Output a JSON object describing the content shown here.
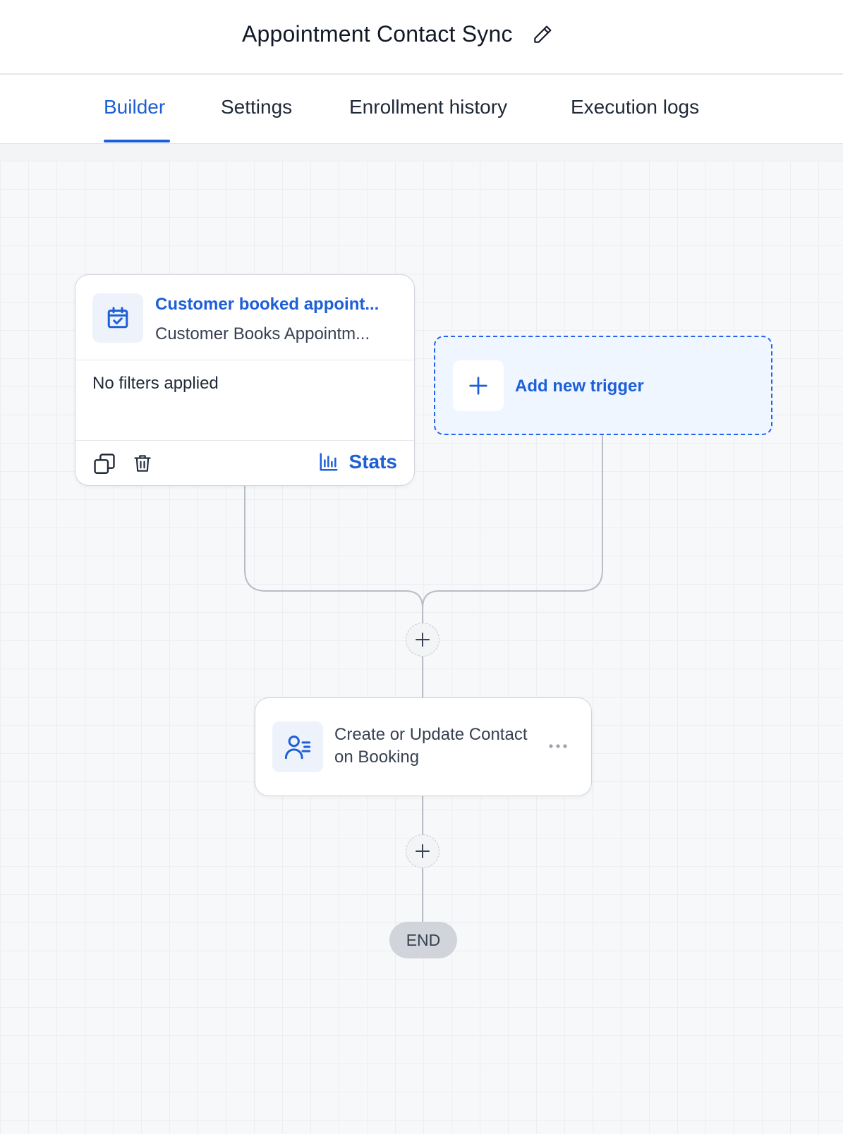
{
  "header": {
    "title": "Appointment Contact Sync",
    "edit_icon": "pencil-icon"
  },
  "tabs": [
    {
      "label": "Builder",
      "active": true
    },
    {
      "label": "Settings",
      "active": false
    },
    {
      "label": "Enrollment history",
      "active": false
    },
    {
      "label": "Execution logs",
      "active": false
    }
  ],
  "trigger": {
    "icon": "calendar-check-icon",
    "title": "Customer booked appoint...",
    "subtitle": "Customer Books Appointm...",
    "filters": "No filters applied",
    "stats_label": "Stats"
  },
  "add_trigger": {
    "label": "Add new trigger"
  },
  "action": {
    "icon": "contact-list-icon",
    "label": "Create or Update Contact on Booking"
  },
  "end_label": "END",
  "colors": {
    "accent": "#1d5fd6",
    "canvas": "#f7f8fa",
    "border": "#d1d5db",
    "add_trigger_bg": "#eff6ff"
  }
}
